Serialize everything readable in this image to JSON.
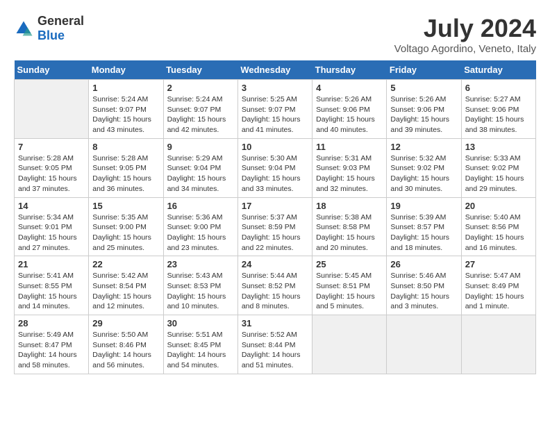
{
  "header": {
    "logo_general": "General",
    "logo_blue": "Blue",
    "title": "July 2024",
    "location": "Voltago Agordino, Veneto, Italy"
  },
  "days_of_week": [
    "Sunday",
    "Monday",
    "Tuesday",
    "Wednesday",
    "Thursday",
    "Friday",
    "Saturday"
  ],
  "weeks": [
    [
      {
        "day": "",
        "info": ""
      },
      {
        "day": "1",
        "info": "Sunrise: 5:24 AM\nSunset: 9:07 PM\nDaylight: 15 hours\nand 43 minutes."
      },
      {
        "day": "2",
        "info": "Sunrise: 5:24 AM\nSunset: 9:07 PM\nDaylight: 15 hours\nand 42 minutes."
      },
      {
        "day": "3",
        "info": "Sunrise: 5:25 AM\nSunset: 9:07 PM\nDaylight: 15 hours\nand 41 minutes."
      },
      {
        "day": "4",
        "info": "Sunrise: 5:26 AM\nSunset: 9:06 PM\nDaylight: 15 hours\nand 40 minutes."
      },
      {
        "day": "5",
        "info": "Sunrise: 5:26 AM\nSunset: 9:06 PM\nDaylight: 15 hours\nand 39 minutes."
      },
      {
        "day": "6",
        "info": "Sunrise: 5:27 AM\nSunset: 9:06 PM\nDaylight: 15 hours\nand 38 minutes."
      }
    ],
    [
      {
        "day": "7",
        "info": "Sunrise: 5:28 AM\nSunset: 9:05 PM\nDaylight: 15 hours\nand 37 minutes."
      },
      {
        "day": "8",
        "info": "Sunrise: 5:28 AM\nSunset: 9:05 PM\nDaylight: 15 hours\nand 36 minutes."
      },
      {
        "day": "9",
        "info": "Sunrise: 5:29 AM\nSunset: 9:04 PM\nDaylight: 15 hours\nand 34 minutes."
      },
      {
        "day": "10",
        "info": "Sunrise: 5:30 AM\nSunset: 9:04 PM\nDaylight: 15 hours\nand 33 minutes."
      },
      {
        "day": "11",
        "info": "Sunrise: 5:31 AM\nSunset: 9:03 PM\nDaylight: 15 hours\nand 32 minutes."
      },
      {
        "day": "12",
        "info": "Sunrise: 5:32 AM\nSunset: 9:02 PM\nDaylight: 15 hours\nand 30 minutes."
      },
      {
        "day": "13",
        "info": "Sunrise: 5:33 AM\nSunset: 9:02 PM\nDaylight: 15 hours\nand 29 minutes."
      }
    ],
    [
      {
        "day": "14",
        "info": "Sunrise: 5:34 AM\nSunset: 9:01 PM\nDaylight: 15 hours\nand 27 minutes."
      },
      {
        "day": "15",
        "info": "Sunrise: 5:35 AM\nSunset: 9:00 PM\nDaylight: 15 hours\nand 25 minutes."
      },
      {
        "day": "16",
        "info": "Sunrise: 5:36 AM\nSunset: 9:00 PM\nDaylight: 15 hours\nand 23 minutes."
      },
      {
        "day": "17",
        "info": "Sunrise: 5:37 AM\nSunset: 8:59 PM\nDaylight: 15 hours\nand 22 minutes."
      },
      {
        "day": "18",
        "info": "Sunrise: 5:38 AM\nSunset: 8:58 PM\nDaylight: 15 hours\nand 20 minutes."
      },
      {
        "day": "19",
        "info": "Sunrise: 5:39 AM\nSunset: 8:57 PM\nDaylight: 15 hours\nand 18 minutes."
      },
      {
        "day": "20",
        "info": "Sunrise: 5:40 AM\nSunset: 8:56 PM\nDaylight: 15 hours\nand 16 minutes."
      }
    ],
    [
      {
        "day": "21",
        "info": "Sunrise: 5:41 AM\nSunset: 8:55 PM\nDaylight: 15 hours\nand 14 minutes."
      },
      {
        "day": "22",
        "info": "Sunrise: 5:42 AM\nSunset: 8:54 PM\nDaylight: 15 hours\nand 12 minutes."
      },
      {
        "day": "23",
        "info": "Sunrise: 5:43 AM\nSunset: 8:53 PM\nDaylight: 15 hours\nand 10 minutes."
      },
      {
        "day": "24",
        "info": "Sunrise: 5:44 AM\nSunset: 8:52 PM\nDaylight: 15 hours\nand 8 minutes."
      },
      {
        "day": "25",
        "info": "Sunrise: 5:45 AM\nSunset: 8:51 PM\nDaylight: 15 hours\nand 5 minutes."
      },
      {
        "day": "26",
        "info": "Sunrise: 5:46 AM\nSunset: 8:50 PM\nDaylight: 15 hours\nand 3 minutes."
      },
      {
        "day": "27",
        "info": "Sunrise: 5:47 AM\nSunset: 8:49 PM\nDaylight: 15 hours\nand 1 minute."
      }
    ],
    [
      {
        "day": "28",
        "info": "Sunrise: 5:49 AM\nSunset: 8:47 PM\nDaylight: 14 hours\nand 58 minutes."
      },
      {
        "day": "29",
        "info": "Sunrise: 5:50 AM\nSunset: 8:46 PM\nDaylight: 14 hours\nand 56 minutes."
      },
      {
        "day": "30",
        "info": "Sunrise: 5:51 AM\nSunset: 8:45 PM\nDaylight: 14 hours\nand 54 minutes."
      },
      {
        "day": "31",
        "info": "Sunrise: 5:52 AM\nSunset: 8:44 PM\nDaylight: 14 hours\nand 51 minutes."
      },
      {
        "day": "",
        "info": ""
      },
      {
        "day": "",
        "info": ""
      },
      {
        "day": "",
        "info": ""
      }
    ]
  ]
}
